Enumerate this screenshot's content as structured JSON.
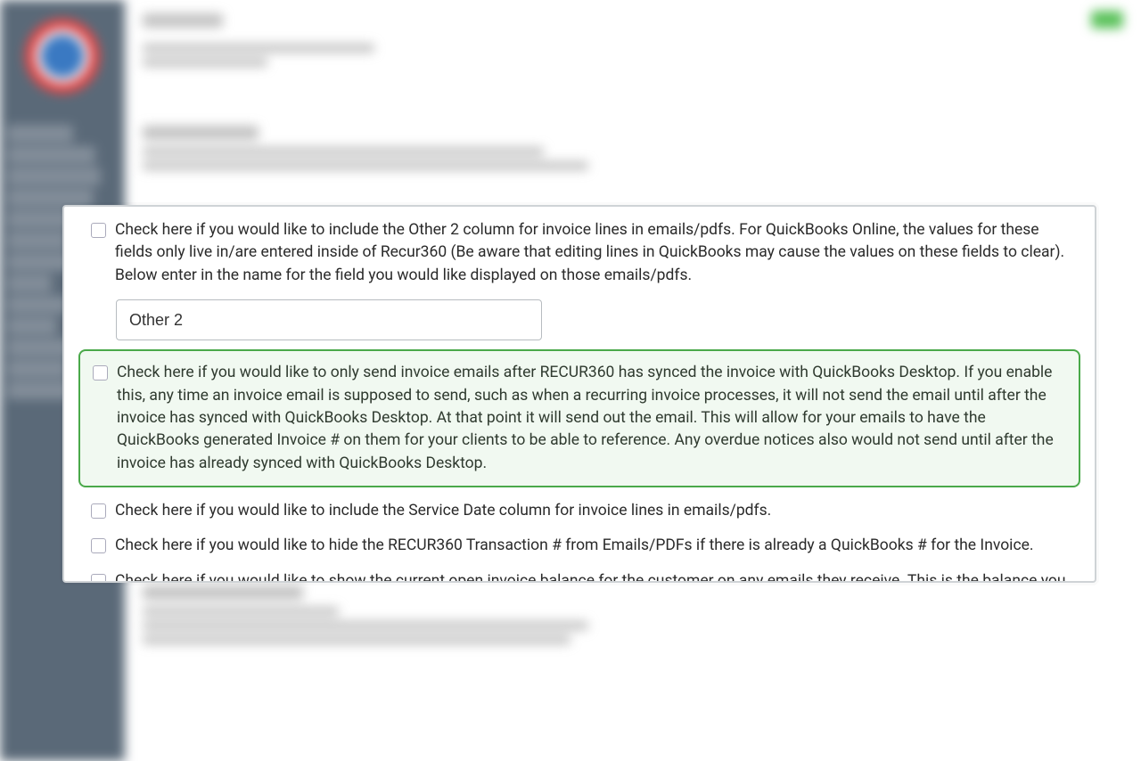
{
  "settings": {
    "other2_label": "Check here if you would like to include the Other 2 column for invoice lines in emails/pdfs. For QuickBooks Online, the values for these fields only live in/are entered inside of Recur360 (Be aware that editing lines in QuickBooks may cause the values on these fields to clear). Below enter in the name for the field you would like displayed on those emails/pdfs.",
    "other2_field_value": "Other 2",
    "sync_before_email_label": "Check here if you would like to only send invoice emails after RECUR360 has synced the invoice with QuickBooks Desktop. If you enable this, any time an invoice email is supposed to send, such as when a recurring invoice processes, it will not send the email until after the invoice has synced with QuickBooks Desktop. At that point it will send out the email. This will allow for your emails to have the QuickBooks generated Invoice # on them for your clients to be able to reference. Any overdue notices also would not send until after the invoice has already synced with QuickBooks Desktop.",
    "service_date_label": "Check here if you would like to include the Service Date column for invoice lines in emails/pdfs.",
    "hide_transaction_label": "Check here if you would like to hide the RECUR360 Transaction # from Emails/PDFs if there is already a QuickBooks # for the Invoice.",
    "open_balance_label": "Check here if you would like to show the current open invoice balance for the customer on any emails they receive. This is the balance you"
  }
}
